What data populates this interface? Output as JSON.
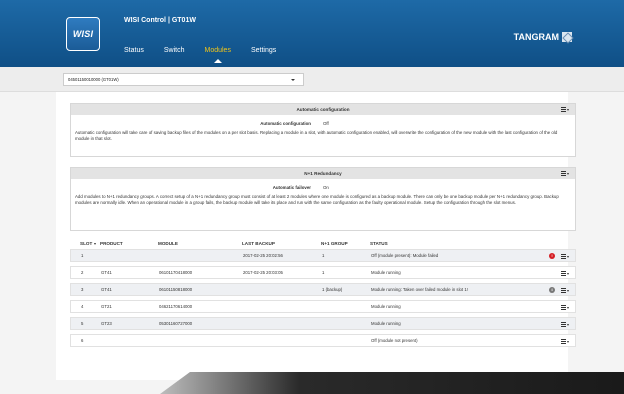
{
  "header": {
    "logo_text": "WISI",
    "app_title": "WISI Control | GT01W",
    "nav": [
      {
        "label": "Status",
        "active": false
      },
      {
        "label": "Switch",
        "active": false
      },
      {
        "label": "Modules",
        "active": true
      },
      {
        "label": "Settings",
        "active": false
      }
    ],
    "brand": "TANGRAM",
    "active_color": "#f0c419"
  },
  "device_select": {
    "value": "04501150010000 (GT01W)"
  },
  "auto_config": {
    "title": "Automatic configuration",
    "label": "Automatic configuration",
    "value": "Off",
    "description": "Automatic configuration will take care of saving backup files of the modules on a per slot basis. Replacing a module in a slot, with automatic configuration enabled, will overwrite the configuration of the new module with the last configuration of the old module in that slot."
  },
  "redundancy": {
    "title": "N+1 Redundancy",
    "label": "Automatic failover",
    "value": "On",
    "description": "Add modules to N+1 redundancy groups. A correct setup of a N+1 redundancy group must consist of at least 2 modules where one module is configured as a backup module. There can only be one backup module per N+1 redundancy group. Backup modules are normally idle. When an operational module in a group fails, the backup module will take its place and run with the same configuration as the faulty operational module. Setup the configuration through the slot menus."
  },
  "table": {
    "headers": [
      "SLOT",
      "PRODUCT",
      "MODULE",
      "LAST BACKUP",
      "N+1 GROUP",
      "STATUS"
    ],
    "rows": [
      {
        "slot": "1",
        "product": "",
        "module": "",
        "backup": "2017-02-25 20:02:56",
        "group": "1",
        "status": "Off (module present): Module failed",
        "icon": "error"
      },
      {
        "slot": "2",
        "product": "GT41",
        "module": "06101170418000",
        "backup": "2017-02-25 20:03:05",
        "group": "1",
        "status": "Module running",
        "icon": ""
      },
      {
        "slot": "3",
        "product": "GT41",
        "module": "06101150818000",
        "backup": "",
        "group": "1 (backup)",
        "status": "Module running: Taken over failed module in slot 1!",
        "icon": "info"
      },
      {
        "slot": "4",
        "product": "GT21",
        "module": "04621170614000",
        "backup": "",
        "group": "",
        "status": "Module running",
        "icon": ""
      },
      {
        "slot": "5",
        "product": "GT23",
        "module": "05301160727000",
        "backup": "",
        "group": "",
        "status": "Module running",
        "icon": ""
      },
      {
        "slot": "6",
        "product": "",
        "module": "",
        "backup": "",
        "group": "",
        "status": "Off (module not present)",
        "icon": ""
      }
    ]
  }
}
